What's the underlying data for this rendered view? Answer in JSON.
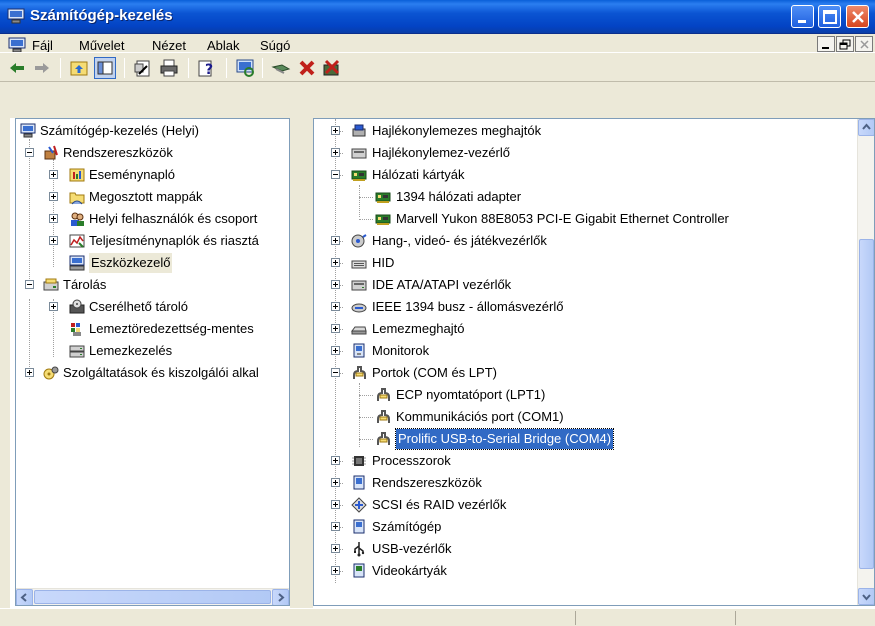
{
  "window": {
    "title": "Számítógép-kezelés"
  },
  "menu": {
    "items": [
      "Fájl",
      "Művelet",
      "Nézet",
      "Ablak",
      "Súgó"
    ]
  },
  "toolbar": {
    "icons": [
      "back-icon",
      "forward-icon",
      "up-icon",
      "show-hide-tree-icon",
      "properties-icon",
      "print-icon",
      "help-icon",
      "scan-hardware-icon",
      "update-driver-icon",
      "uninstall-icon",
      "disable-icon"
    ]
  },
  "left_tree": [
    {
      "label": "Számítógép-kezelés (Helyi)",
      "icon": "computer-management-icon"
    },
    {
      "label": "Rendszereszközök",
      "icon": "system-tools-icon"
    },
    {
      "label": "Eseménynapló",
      "icon": "event-viewer-icon"
    },
    {
      "label": "Megosztott mappák",
      "icon": "shared-folders-icon"
    },
    {
      "label": "Helyi felhasználók és csoport",
      "icon": "users-icon"
    },
    {
      "label": "Teljesítménynaplók és riasztá",
      "icon": "performance-icon"
    },
    {
      "label": "Eszközkezelő",
      "icon": "device-manager-icon"
    },
    {
      "label": "Tárolás",
      "icon": "storage-icon"
    },
    {
      "label": "Cserélhető tároló",
      "icon": "removable-storage-icon"
    },
    {
      "label": "Lemeztöredezettség-mentes",
      "icon": "defrag-icon"
    },
    {
      "label": "Lemezkezelés",
      "icon": "disk-management-icon"
    },
    {
      "label": "Szolgáltatások és kiszolgálói alkal",
      "icon": "services-icon"
    }
  ],
  "device_tree": [
    {
      "label": "Hajlékonylemezes meghajtók",
      "icon": "floppy-drive-icon"
    },
    {
      "label": "Hajlékonylemez-vezérlő",
      "icon": "floppy-controller-icon"
    },
    {
      "label": "Hálózati kártyák",
      "icon": "network-card-icon"
    },
    {
      "label": "1394 hálózati adapter",
      "icon": "network-card-icon"
    },
    {
      "label": "Marvell Yukon 88E8053 PCI-E Gigabit Ethernet Controller",
      "icon": "network-card-icon"
    },
    {
      "label": "Hang-, videó- és játékvezérlők",
      "icon": "sound-icon"
    },
    {
      "label": "HID",
      "icon": "hid-icon"
    },
    {
      "label": "IDE ATA/ATAPI vezérlők",
      "icon": "ide-icon"
    },
    {
      "label": "IEEE 1394 busz - állomásvezérlő",
      "icon": "ieee1394-icon"
    },
    {
      "label": "Lemezmeghajtó",
      "icon": "disk-drive-icon"
    },
    {
      "label": "Monitorok",
      "icon": "monitor-icon"
    },
    {
      "label": "Portok (COM és LPT)",
      "icon": "port-icon"
    },
    {
      "label": "ECP nyomtatóport (LPT1)",
      "icon": "port-icon"
    },
    {
      "label": "Kommunikációs port (COM1)",
      "icon": "port-icon"
    },
    {
      "label": "Prolific USB-to-Serial Bridge (COM4)",
      "icon": "port-icon"
    },
    {
      "label": "Processzorok",
      "icon": "processor-icon"
    },
    {
      "label": "Rendszereszközök",
      "icon": "system-devices-icon"
    },
    {
      "label": "SCSI és RAID vezérlők",
      "icon": "scsi-icon"
    },
    {
      "label": "Számítógép",
      "icon": "computer-icon"
    },
    {
      "label": "USB-vezérlők",
      "icon": "usb-icon"
    },
    {
      "label": "Videokártyák",
      "icon": "display-adapter-icon"
    }
  ],
  "colors": {
    "titlebar": "#0b55d3",
    "selection": "#316ac5",
    "chrome": "#ece9d8"
  }
}
